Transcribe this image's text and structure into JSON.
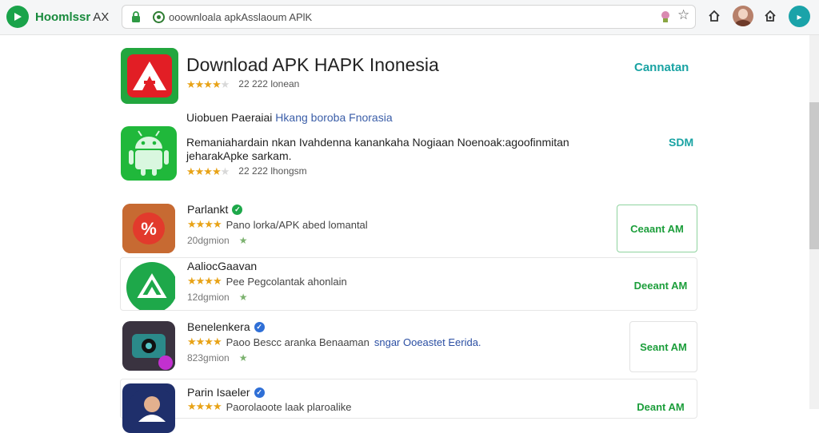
{
  "browser": {
    "brand_name": "Hoomlssr",
    "brand_suffix": "AX",
    "address": "ooownloala apkAsslaoum APlK",
    "lock_icon": "lock-icon",
    "colors": {
      "brand": "#1aa34a",
      "accent": "#19a3a3"
    }
  },
  "hero": {
    "title": "Download APK HAPK Inonesia",
    "rating_stars": 4.5,
    "stars": "★★★★",
    "stars_off": "★",
    "meta": "22 222 lonean",
    "link": "Cannatan"
  },
  "subsection": {
    "heading_part1": "Uiobuen Paeraiai",
    "heading_part2": "Hkang boroba Fnorasia",
    "description": "Remaniahardain nkan Ivahdenna kanankaha Nogiaan Noenoak:agoofinmitan jeharakApke sarkam.",
    "rating_stars": 4.5,
    "stars": "★★★★",
    "stars_off": "★",
    "meta": "22 222 lhongsm",
    "link": "SDM"
  },
  "apps": [
    {
      "title": "Parlankt",
      "rating": 4,
      "stars": "★★★★",
      "line": "Pano lorka/APK abed lomantal",
      "line_blue": "",
      "meta": "20dgmion",
      "button": "Ceaant AM",
      "verified_color": "#1ea84a"
    },
    {
      "title": "AaliocGaavan",
      "rating": 3.5,
      "stars": "★★★★",
      "line": "Pee Pegcolantak ahonlain",
      "line_blue": "",
      "meta": "12dgmion",
      "button": "Deeant AM",
      "verified_color": ""
    },
    {
      "title": "Benelenkera",
      "rating": 4,
      "stars": "★★★★",
      "line": "Paoo Bescc aranka Benaaman",
      "line_blue": "sngar Ooeastet Eerida.",
      "meta": "823gmion",
      "button": "Seant AM",
      "verified_color": "#2f6fd6"
    },
    {
      "title": "Parin Isaeler",
      "rating": 4,
      "stars": "★★★★",
      "line": "Paorolaoote laak plaroalike",
      "line_blue": "",
      "meta": "",
      "button": "Deant AM",
      "verified_color": "#2f6fd6"
    }
  ]
}
